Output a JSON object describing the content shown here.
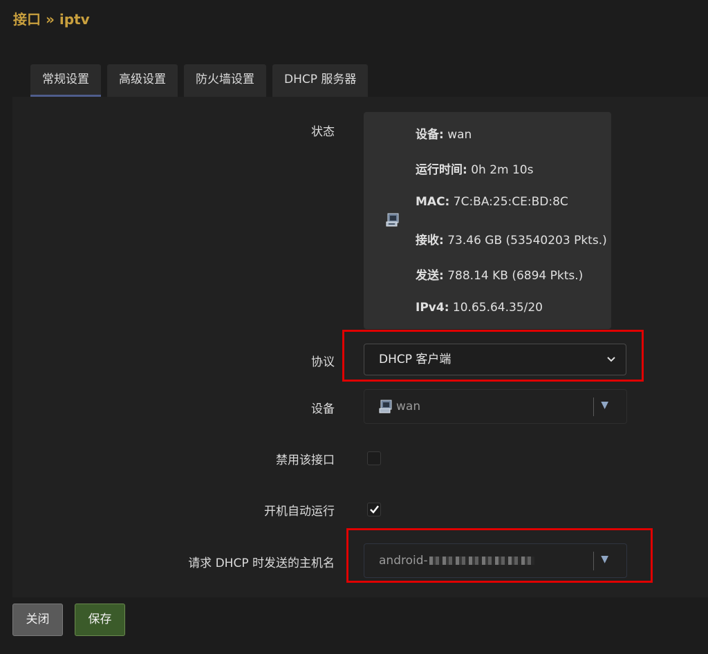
{
  "page_title": "接口 » iptv",
  "tabs": [
    {
      "label": "常规设置",
      "active": true
    },
    {
      "label": "高级设置"
    },
    {
      "label": "防火墙设置"
    },
    {
      "label": "DHCP 服务器"
    }
  ],
  "status": {
    "label": "状态",
    "device_key": "设备:",
    "device_val": " wan",
    "uptime_key": "运行时间:",
    "uptime_val": " 0h 2m 10s",
    "mac_key": "MAC:",
    "mac_val": " 7C:BA:25:CE:BD:8C",
    "rx_key": "接收:",
    "rx_val": " 73.46 GB (53540203 Pkts.)",
    "tx_key": "发送:",
    "tx_val": " 788.14 KB (6894 Pkts.)",
    "ipv4_key": "IPv4:",
    "ipv4_val": " 10.65.64.35/20",
    "icon": "ethernet-port-icon"
  },
  "protocol": {
    "label": "协议",
    "value": "DHCP 客户端"
  },
  "device": {
    "label": "设备",
    "value": "wan"
  },
  "disable": {
    "label": "禁用该接口",
    "checked": false
  },
  "autostart": {
    "label": "开机自动运行",
    "checked": true
  },
  "hostname": {
    "label": "请求 DHCP 时发送的主机名",
    "value": "android-"
  },
  "buttons": {
    "close": "关闭",
    "save": "保存"
  },
  "colors": {
    "accent_title": "#c9a03e",
    "highlight": "#e00000",
    "save_bg": "#3b5b2a"
  }
}
